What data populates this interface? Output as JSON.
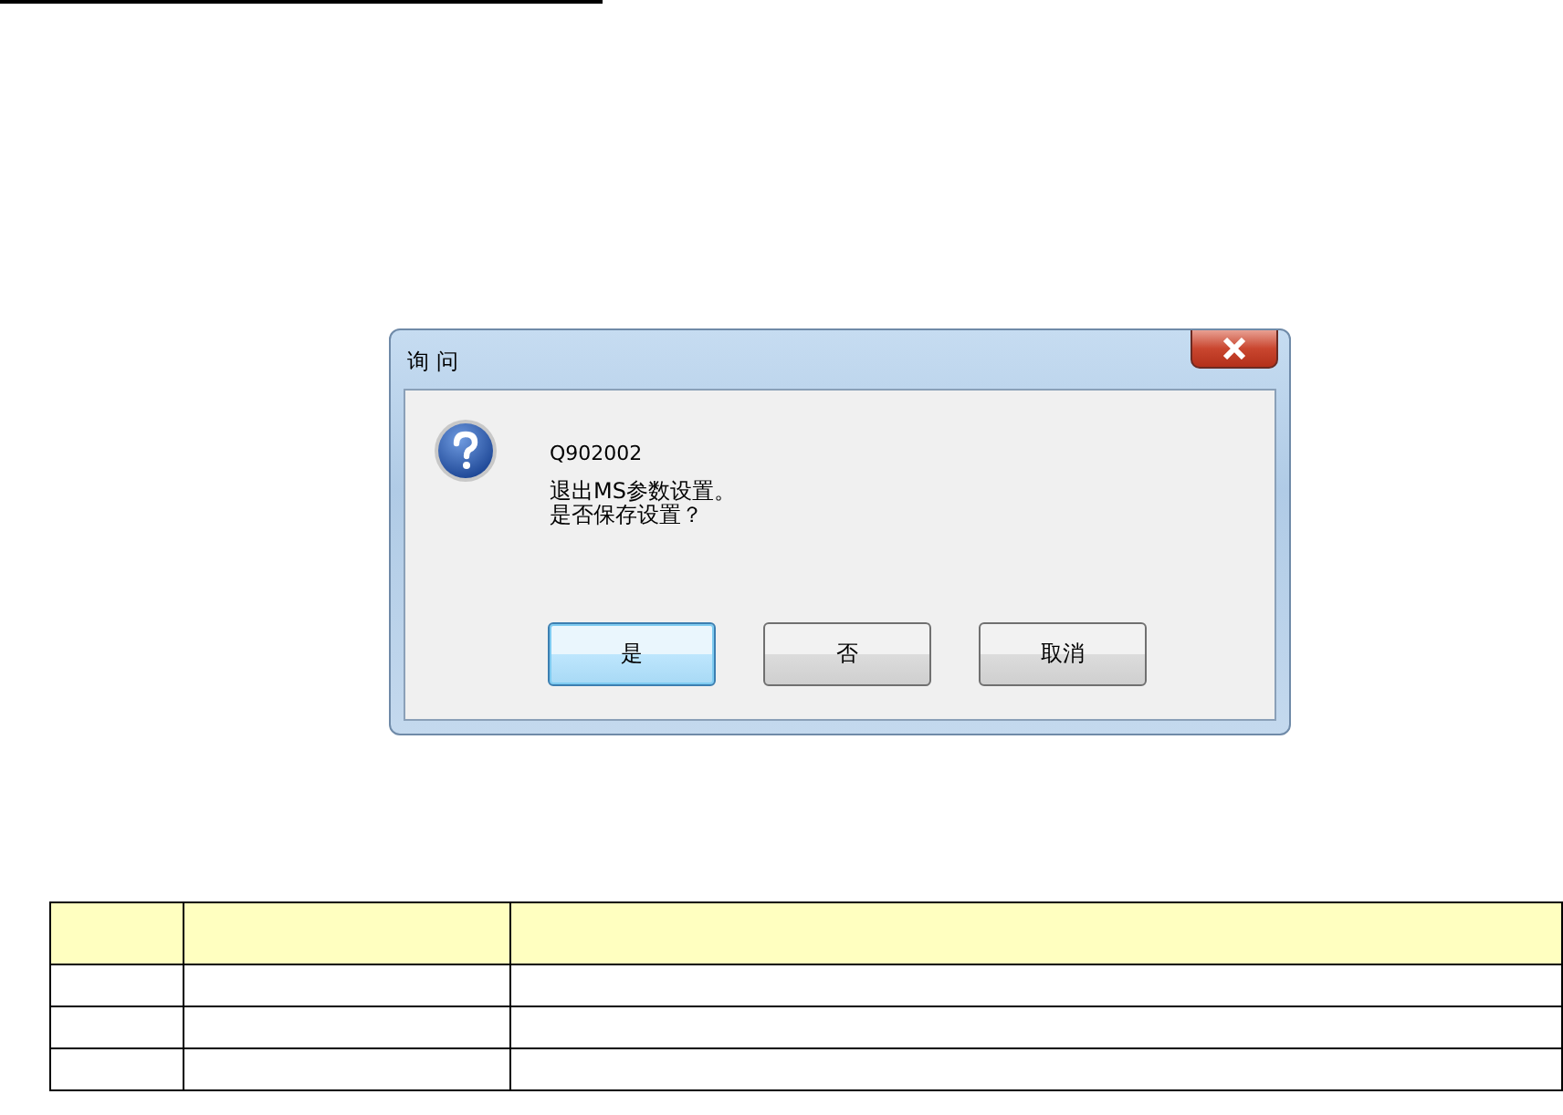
{
  "dialog": {
    "title": "询 问",
    "code": "Q902002",
    "message_lines": [
      "退出MS参数设置。",
      "是否保存设置？"
    ],
    "buttons": [
      {
        "label": "是",
        "default": true
      },
      {
        "label": "否",
        "default": false
      },
      {
        "label": "取消",
        "default": false
      }
    ]
  }
}
